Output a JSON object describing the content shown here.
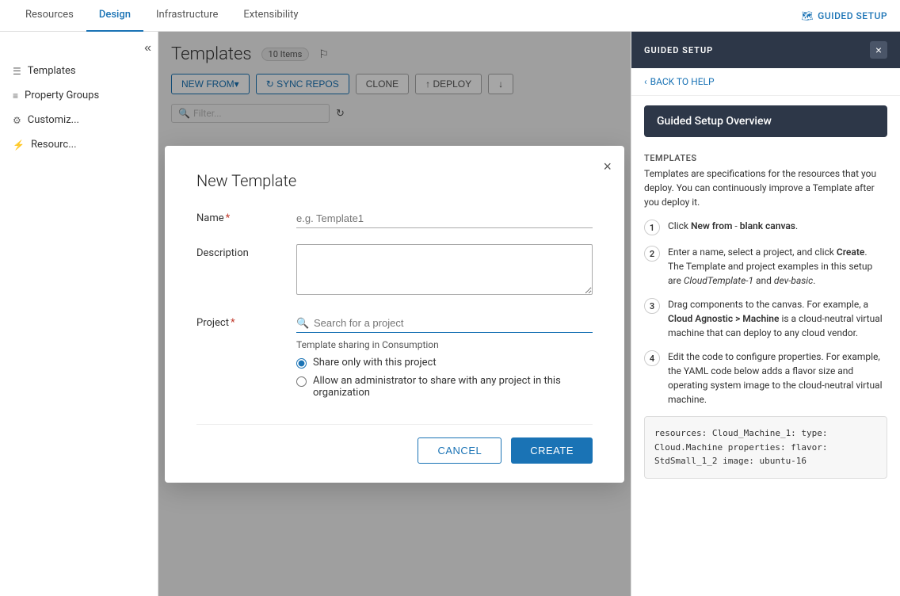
{
  "topnav": {
    "tabs": [
      {
        "label": "Resources",
        "active": false
      },
      {
        "label": "Design",
        "active": true
      },
      {
        "label": "Infrastructure",
        "active": false
      },
      {
        "label": "Extensibility",
        "active": false
      }
    ],
    "guided_setup_label": "GUIDED SETUP"
  },
  "sidebar": {
    "collapse_icon": "«",
    "items": [
      {
        "label": "Templates",
        "icon": "☰"
      },
      {
        "label": "Property Groups",
        "icon": "≡"
      },
      {
        "label": "Customiz...",
        "icon": "⚙"
      },
      {
        "label": "Resourc...",
        "icon": "⚡"
      }
    ]
  },
  "content": {
    "title": "Templates",
    "items_count": "10 Items",
    "toolbar": {
      "new_from_label": "NEW FROM▾",
      "sync_repos_label": "↻  SYNC REPOS",
      "clone_label": "CLONE",
      "deploy_label": "↑ DEPLOY",
      "download_icon": "↓"
    },
    "filter_placeholder": "Filter..."
  },
  "right_panel": {
    "header": "GUIDED SETUP",
    "close_icon": "×",
    "back_label": "‹ BACK TO HELP",
    "overview_title": "Guided Setup Overview",
    "section_label": "TEMPLATES",
    "intro_text": "Templates are specifications for the resources that you deploy. You can continuously improve a Template after you deploy it.",
    "steps": [
      {
        "number": "1",
        "text_parts": [
          {
            "text": "Click ",
            "bold": false,
            "italic": false
          },
          {
            "text": "New from",
            "bold": true,
            "italic": false
          },
          {
            "text": " - ",
            "bold": false,
            "italic": false
          },
          {
            "text": "blank canvas",
            "bold": true,
            "italic": false
          },
          {
            "text": ".",
            "bold": false,
            "italic": false
          }
        ]
      },
      {
        "number": "2",
        "text": "Enter a name, select a project, and click Create.\nThe Template and project examples in this setup are CloudTemplate-1 and dev-basic."
      },
      {
        "number": "3",
        "text": "Drag components to the canvas. For example, a Cloud Agnostic > Machine is a cloud-neutral virtual machine that can deploy to any cloud vendor."
      },
      {
        "number": "4",
        "text": "Edit the code to configure properties. For example, the YAML code below adds a flavor size and operating system image to the cloud-neutral virtual machine."
      }
    ],
    "code": "resources:\n  Cloud_Machine_1:\n    type: Cloud.Machine\n    properties:\n      flavor: StdSmall_1_2\n      image: ubuntu-16"
  },
  "modal": {
    "title": "New Template",
    "close_icon": "×",
    "name_label": "Name",
    "name_placeholder": "e.g. Template1",
    "description_label": "Description",
    "project_label": "Project",
    "project_placeholder": "Search for a project",
    "sharing_label": "Template sharing in Consumption",
    "radio_options": [
      {
        "label": "Share only with this project",
        "checked": true
      },
      {
        "label": "Allow an administrator to share with any project in this organization",
        "checked": false
      }
    ],
    "cancel_label": "CANCEL",
    "create_label": "CREATE"
  }
}
